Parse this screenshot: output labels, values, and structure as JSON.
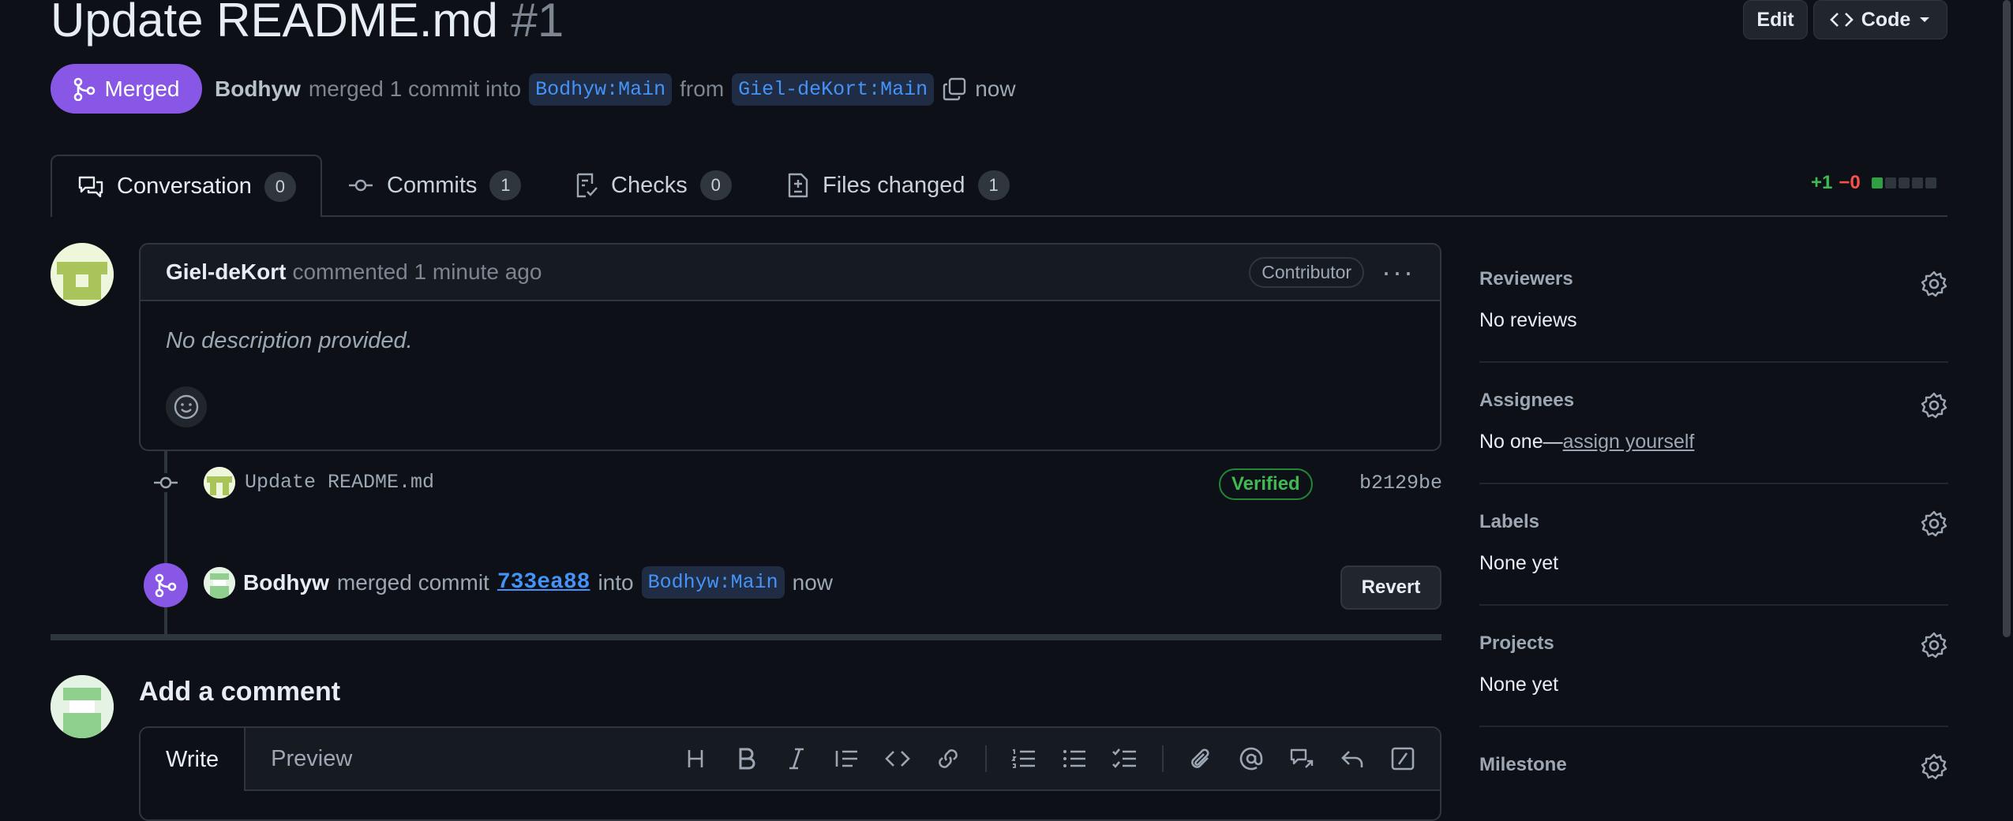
{
  "header": {
    "title": "Update README.md",
    "number": "#1",
    "edit_label": "Edit",
    "code_label": "Code"
  },
  "status": {
    "badge": "Merged",
    "author": "Bodhyw",
    "summary": "merged 1 commit into",
    "base_branch": "Bodhyw:Main",
    "from_word": "from",
    "head_branch": "Giel-deKort:Main",
    "time": "now"
  },
  "tabs": [
    {
      "label": "Conversation",
      "count": "0"
    },
    {
      "label": "Commits",
      "count": "1"
    },
    {
      "label": "Checks",
      "count": "0"
    },
    {
      "label": "Files changed",
      "count": "1"
    }
  ],
  "diffstat": {
    "additions": "+1",
    "deletions": "−0"
  },
  "comment": {
    "author": "Giel-deKort",
    "action": "commented 1 minute ago",
    "role": "Contributor",
    "body": "No description provided."
  },
  "commit": {
    "message": "Update README.md",
    "badge": "Verified",
    "sha": "b2129be"
  },
  "merge_event": {
    "author": "Bodhyw",
    "text": "merged commit",
    "sha": "733ea88",
    "into": "into",
    "branch": "Bodhyw:Main",
    "time": "now",
    "revert_label": "Revert"
  },
  "add_comment": {
    "title": "Add a comment",
    "write_tab": "Write",
    "preview_tab": "Preview"
  },
  "sidebar": {
    "reviewers": {
      "title": "Reviewers",
      "value": "No reviews"
    },
    "assignees": {
      "title": "Assignees",
      "value": "No one—",
      "link": "assign yourself"
    },
    "labels": {
      "title": "Labels",
      "value": "None yet"
    },
    "projects": {
      "title": "Projects",
      "value": "None yet"
    },
    "milestone": {
      "title": "Milestone"
    }
  },
  "colors": {
    "background": "#0d1117",
    "merged_purple": "#8957e5",
    "link_blue": "#4493f8",
    "verified_green": "#3fb950",
    "deletion_red": "#f85149"
  }
}
